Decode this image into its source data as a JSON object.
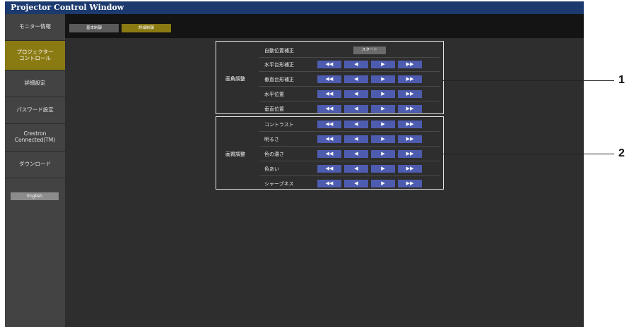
{
  "window": {
    "title": "Projector Control Window"
  },
  "sidebar": {
    "items": [
      {
        "label": "モニター情報"
      },
      {
        "label": "プロジェクター\nコントロール"
      },
      {
        "label": "詳細設定"
      },
      {
        "label": "パスワード設定"
      },
      {
        "label": "Crestron\nConnected(TM)"
      },
      {
        "label": "ダウンロード"
      }
    ],
    "english_button": "English"
  },
  "tabs": [
    {
      "label": "基本制御"
    },
    {
      "label": "詳細制御"
    }
  ],
  "geometry_group": {
    "label": "画角調整",
    "rows": [
      {
        "label": "自動位置補正",
        "start_button": "スタート"
      },
      {
        "label": "水平台形補正"
      },
      {
        "label": "垂直台形補正"
      },
      {
        "label": "水平位置"
      },
      {
        "label": "垂直位置"
      }
    ]
  },
  "image_group": {
    "label": "画質調整",
    "rows": [
      {
        "label": "コントラスト"
      },
      {
        "label": "明るさ"
      },
      {
        "label": "色の濃さ"
      },
      {
        "label": "色あい"
      },
      {
        "label": "シャープネス"
      }
    ]
  },
  "controls": {
    "fast_left": "◀◀",
    "left": "◀",
    "right": "▶",
    "fast_right": "▶▶"
  },
  "callouts": [
    "1",
    "2"
  ],
  "colors": {
    "title_bar": "#1c3a6e",
    "active": "#8a7a12",
    "control_button": "#4e5cb0"
  }
}
